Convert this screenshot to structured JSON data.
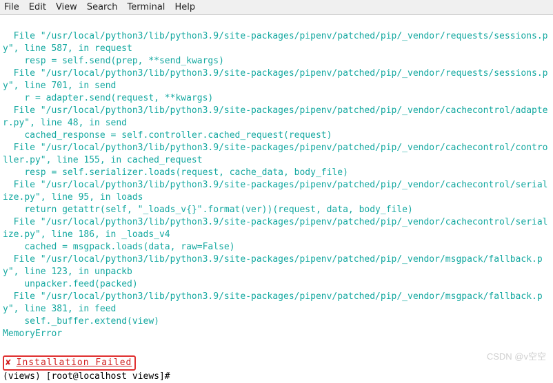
{
  "menubar": {
    "file": "File",
    "edit": "Edit",
    "view": "View",
    "search": "Search",
    "terminal": "Terminal",
    "help": "Help"
  },
  "trace": [
    "  File \"/usr/local/python3/lib/python3.9/site-packages/pipenv/patched/pip/_vendor/requests/sessions.py\", line 587, in request",
    "    resp = self.send(prep, **send_kwargs)",
    "  File \"/usr/local/python3/lib/python3.9/site-packages/pipenv/patched/pip/_vendor/requests/sessions.py\", line 701, in send",
    "    r = adapter.send(request, **kwargs)",
    "  File \"/usr/local/python3/lib/python3.9/site-packages/pipenv/patched/pip/_vendor/cachecontrol/adapter.py\", line 48, in send",
    "    cached_response = self.controller.cached_request(request)",
    "  File \"/usr/local/python3/lib/python3.9/site-packages/pipenv/patched/pip/_vendor/cachecontrol/controller.py\", line 155, in cached_request",
    "    resp = self.serializer.loads(request, cache_data, body_file)",
    "  File \"/usr/local/python3/lib/python3.9/site-packages/pipenv/patched/pip/_vendor/cachecontrol/serialize.py\", line 95, in loads",
    "    return getattr(self, \"_loads_v{}\".format(ver))(request, data, body_file)",
    "  File \"/usr/local/python3/lib/python3.9/site-packages/pipenv/patched/pip/_vendor/cachecontrol/serialize.py\", line 186, in _loads_v4",
    "    cached = msgpack.loads(data, raw=False)",
    "  File \"/usr/local/python3/lib/python3.9/site-packages/pipenv/patched/pip/_vendor/msgpack/fallback.py\", line 123, in unpackb",
    "    unpacker.feed(packed)",
    "  File \"/usr/local/python3/lib/python3.9/site-packages/pipenv/patched/pip/_vendor/msgpack/fallback.py\", line 381, in feed",
    "    self._buffer.extend(view)"
  ],
  "error": "MemoryError",
  "fail": {
    "mark": "✘",
    "text": "Installation Failed"
  },
  "prompt": "(views) [root@localhost views]#",
  "watermark": "CSDN @v空空"
}
